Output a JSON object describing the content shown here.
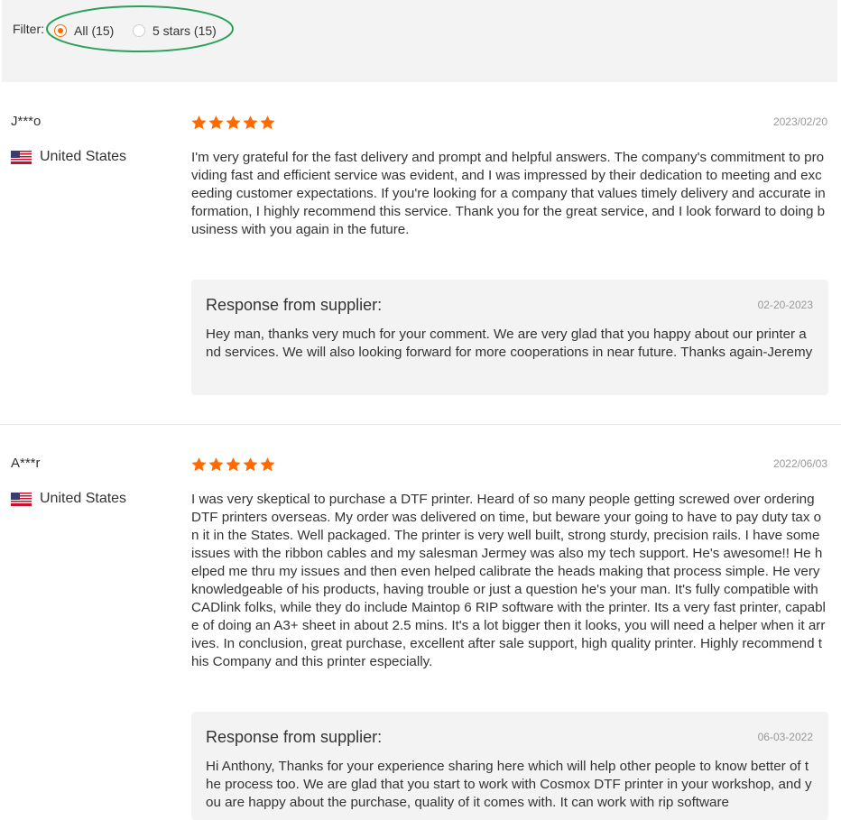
{
  "filter": {
    "label": "Filter:",
    "options": [
      {
        "label": "All (15)",
        "checked": true
      },
      {
        "label": "5 stars (15)",
        "checked": false
      }
    ]
  },
  "colors": {
    "accent": "#ff6a00",
    "annotation": "#2aa05a"
  },
  "reviews": [
    {
      "reviewer": "J***o",
      "country": "United States",
      "flag_icon": "us-flag-icon",
      "stars": 5,
      "date": "2023/02/20",
      "text": "I'm very grateful for the fast delivery and prompt and helpful answers. The company's commitment to providing fast and efficient service was evident, and I was impressed by their dedication to meeting and exceeding customer expectations. If you're looking for a company that values timely delivery and accurate information, I highly recommend this service. Thank you for the great service, and I look forward to doing business with you again in the future.",
      "response": {
        "title": "Response from supplier:",
        "date": "02-20-2023",
        "text": "Hey man, thanks very much for your comment. We are very glad that you happy about our printer and services. We will also looking forward for more cooperations in near future. Thanks again-Jeremy"
      }
    },
    {
      "reviewer": "A***r",
      "country": "United States",
      "flag_icon": "us-flag-icon",
      "stars": 5,
      "date": "2022/06/03",
      "text": "I was very skeptical to purchase a DTF printer. Heard of so many people getting screwed over ordering DTF printers overseas. My order was delivered on time, but beware your going to have to pay duty tax on it in the States. Well packaged. The printer is very well built, strong sturdy, precision rails. I have some issues with the ribbon cables and my salesman Jermey was also my tech support. He's awesome!! He helped me thru my issues and then even helped calibrate the heads making that process simple. He very knowledgeable of his products, having trouble or just a question he's your man. It's fully compatible with CADlink folks, while they do include Maintop 6 RIP software with the printer. Its a very fast printer, capable of doing an A3+ sheet in about 2.5 mins. It's a lot bigger then it looks, you will need a helper when it arrives. In conclusion, great purchase, excellent after sale support, high quality printer. Highly recommend this Company and this printer especially.",
      "response": {
        "title": "Response from supplier:",
        "date": "06-03-2022",
        "text": "Hi Anthony, Thanks for your experience sharing here which will help other people to know better of the process too. We are glad that you start to work with Cosmox DTF printer in your workshop, and you are happy about the purchase, quality of it comes with. It can work with rip software"
      }
    }
  ]
}
